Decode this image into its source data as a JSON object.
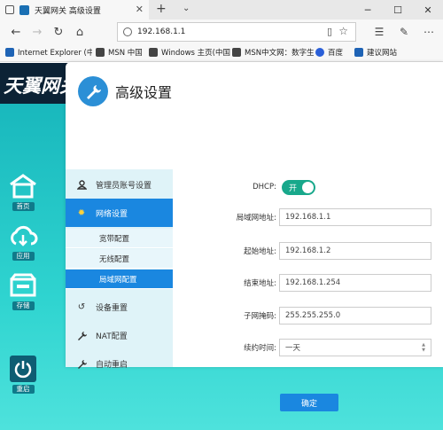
{
  "browser": {
    "tab_title": "天翼网关 高级设置",
    "address": "192.168.1.1",
    "favorites": [
      "Internet Explorer (中国",
      "MSN 中国",
      "Windows 主页(中国)",
      "MSN中文网：数字生",
      "百度",
      "建议网站"
    ]
  },
  "header": {
    "logo": "天翼网关"
  },
  "leftnav": {
    "items": [
      {
        "label": "首页"
      },
      {
        "label": "应用"
      },
      {
        "label": "存储"
      },
      {
        "label": "重启"
      }
    ]
  },
  "panel": {
    "title": "高级设置"
  },
  "menu": {
    "items": [
      {
        "label": "管理员账号设置"
      },
      {
        "label": "网络设置"
      },
      {
        "label": "设备重置"
      },
      {
        "label": "NAT配置"
      },
      {
        "label": "自动重启"
      }
    ],
    "subitems": [
      {
        "label": "宽带配置"
      },
      {
        "label": "无线配置"
      },
      {
        "label": "局域网配置"
      }
    ]
  },
  "form": {
    "dhcp_label": "DHCP:",
    "dhcp_state": "开",
    "lan_ip_label": "局域网地址:",
    "lan_ip": "192.168.1.1",
    "start_label": "起始地址:",
    "start_ip": "192.168.1.2",
    "end_label": "结束地址:",
    "end_ip": "192.168.1.254",
    "mask_label": "子网掩码:",
    "mask": "255.255.255.0",
    "lease_label": "续约时间:",
    "lease_value": "一天",
    "submit_label": "确定"
  },
  "colors": {
    "accent": "#1a87e0",
    "toggle_on": "#18a88b",
    "header_bg": "#0c2235",
    "teal": "#20c8c8"
  }
}
